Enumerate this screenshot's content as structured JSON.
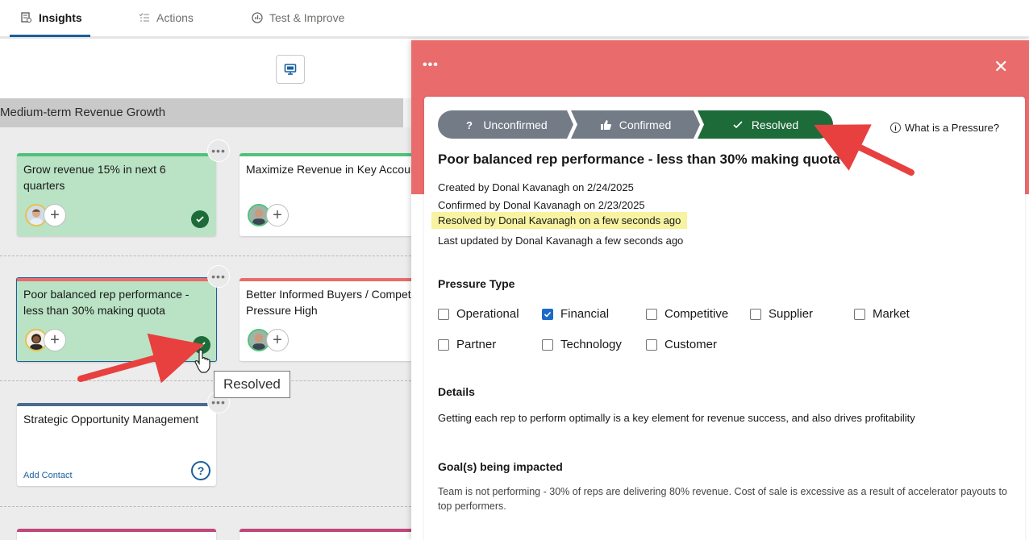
{
  "tabs": [
    {
      "label": "Insights",
      "icon": "insights-icon",
      "active": true
    },
    {
      "label": "Actions",
      "icon": "list-icon",
      "active": false
    },
    {
      "label": "Test & Improve",
      "icon": "chart-icon",
      "active": false
    }
  ],
  "board": {
    "section_title": "Medium-term Revenue Growth",
    "cards": [
      {
        "title": "Grow revenue 15% in next 6 quarters",
        "status": "resolved"
      },
      {
        "title": "Maximize Revenue in Key Accounts"
      },
      {
        "title": "Poor balanced rep performance - less than 30% making quota",
        "status": "resolved"
      },
      {
        "title": "Better Informed Buyers / Competitive Pressure High"
      },
      {
        "title": "Strategic Opportunity Management",
        "add_contact": "Add Contact"
      }
    ],
    "tooltip": "Resolved"
  },
  "panel": {
    "steps": [
      {
        "label": "Unconfirmed",
        "icon": "question-icon"
      },
      {
        "label": "Confirmed",
        "icon": "thumbs-up-icon"
      },
      {
        "label": "Resolved",
        "icon": "check-icon"
      }
    ],
    "help_link": "What is a Pressure?",
    "title": "Poor balanced rep performance - less than 30% making quota",
    "created": "Created by Donal Kavanagh on 2/24/2025",
    "confirmed": "Confirmed by Donal Kavanagh on 2/23/2025",
    "resolved": "Resolved by Donal Kavanagh on a few seconds ago",
    "updated": "Last updated by Donal Kavanagh a few seconds ago",
    "pressure_type_heading": "Pressure Type",
    "pressure_types_row1": [
      {
        "label": "Operational",
        "checked": false
      },
      {
        "label": "Financial",
        "checked": true
      },
      {
        "label": "Competitive",
        "checked": false
      },
      {
        "label": "Supplier",
        "checked": false
      },
      {
        "label": "Market",
        "checked": false
      }
    ],
    "pressure_types_row2": [
      {
        "label": "Partner",
        "checked": false
      },
      {
        "label": "Technology",
        "checked": false
      },
      {
        "label": "Customer",
        "checked": false
      }
    ],
    "details_heading": "Details",
    "details_text": "Getting each rep to perform optimally is a key element for revenue success, and also drives profitability",
    "goals_heading": "Goal(s) being impacted",
    "goals_text": "Team is not performing - 30% of reps are delivering 80% revenue. Cost of sale is excessive as a result of accelerator payouts to top performers."
  },
  "colors": {
    "panel_header": "#ea6b6b",
    "resolved_green": "#1e6b3a",
    "step_gray": "#737b87",
    "highlight": "#f7f3a1",
    "annotation_arrow": "#e8403f"
  }
}
